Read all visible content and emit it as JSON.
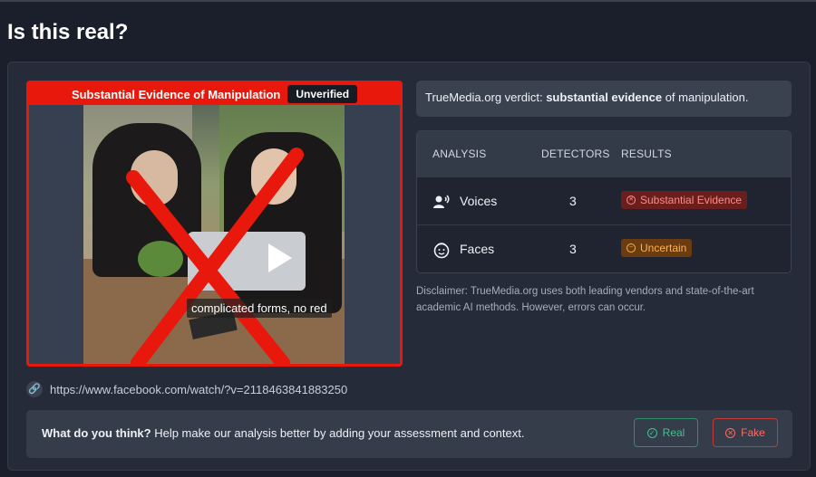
{
  "page": {
    "title": "Is this real?"
  },
  "video": {
    "banner_text": "Substantial Evidence of Manipulation",
    "banner_badge": "Unverified",
    "caption": "complicated forms, no red"
  },
  "verdict": {
    "prefix": "TrueMedia.org verdict: ",
    "emphasis": "substantial evidence",
    "suffix": " of manipulation."
  },
  "analysis": {
    "headers": {
      "analysis": "ANALYSIS",
      "detectors": "DETECTORS",
      "results": "RESULTS"
    },
    "rows": [
      {
        "label": "Voices",
        "icon": "voice-icon",
        "detectors": "3",
        "result": "Substantial Evidence",
        "result_color": "#ff8d84",
        "result_icon": "x-circle-icon"
      },
      {
        "label": "Faces",
        "icon": "face-scan-icon",
        "detectors": "3",
        "result": "Uncertain",
        "result_color": "#ffb24a",
        "result_icon": "minus-circle-icon"
      }
    ]
  },
  "disclaimer": "Disclaimer: TrueMedia.org uses both leading vendors and state-of-the-art academic AI methods. However, errors can occur.",
  "source": {
    "url": "https://www.facebook.com/watch/?v=2118463841883250",
    "icon": "link-icon"
  },
  "feedback": {
    "question": "What do you think?",
    "prompt": " Help make our analysis better by adding your assessment and context.",
    "real_label": "Real",
    "fake_label": "Fake"
  },
  "colors": {
    "background": "#1a1f2b",
    "card": "#252b38",
    "manipulation_red": "#e8180c",
    "real_green": "#45c08e",
    "fake_red": "#ff6b63"
  }
}
